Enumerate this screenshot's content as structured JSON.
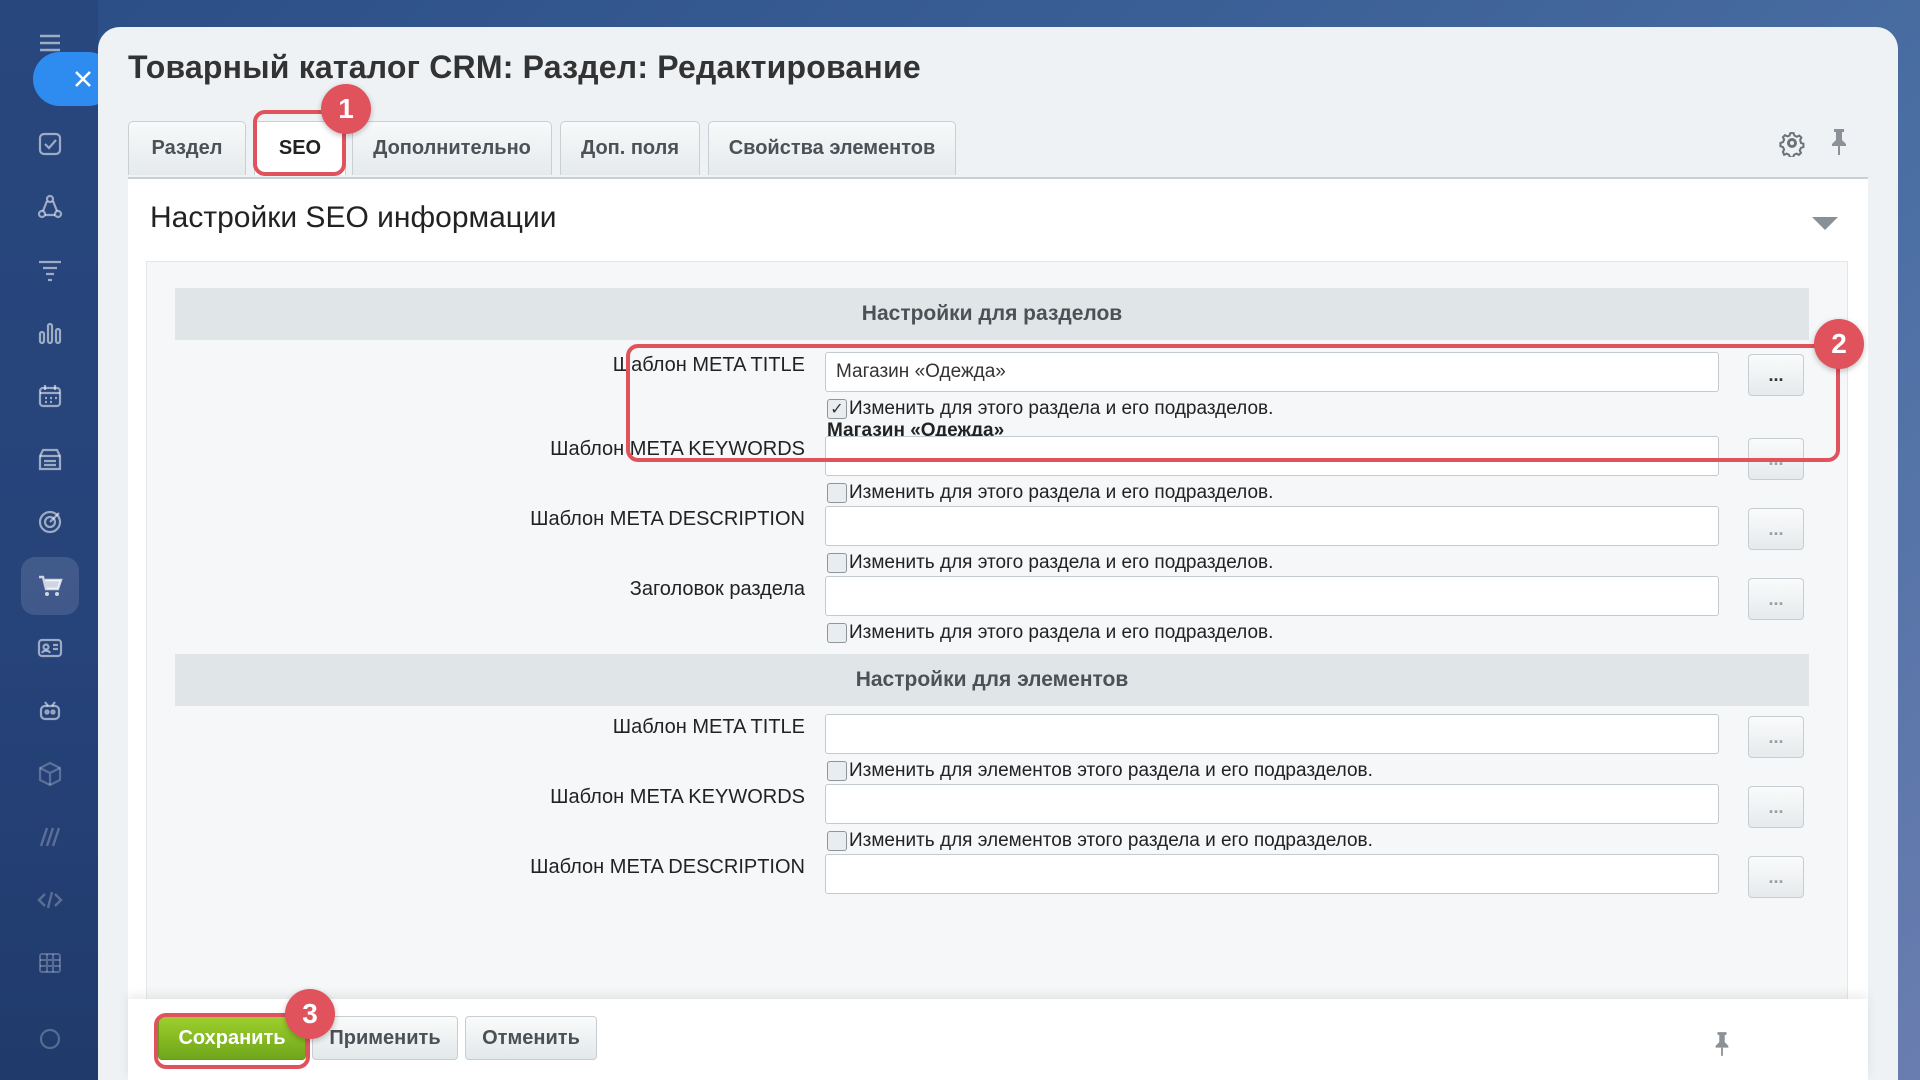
{
  "window": {
    "title": "Товарный каталог CRM: Раздел: Редактирование"
  },
  "tabs": [
    {
      "label": "Раздел"
    },
    {
      "label": "SEO"
    },
    {
      "label": "Дополнительно"
    },
    {
      "label": "Доп. поля"
    },
    {
      "label": "Свойства элементов"
    }
  ],
  "section": {
    "title": "Настройки SEO информации"
  },
  "groups": {
    "sections": {
      "header": "Настройки для разделов",
      "rows": [
        {
          "label": "Шаблон META TITLE",
          "value": "Магазин «Одежда»",
          "checkbox": "Изменить для этого раздела и его подразделов.",
          "checked": true,
          "preview": "Магазин «Одежда»",
          "button": "..."
        },
        {
          "label": "Шаблон META KEYWORDS",
          "value": "",
          "checkbox": "Изменить для этого раздела и его подразделов.",
          "checked": false,
          "button": "..."
        },
        {
          "label": "Шаблон META DESCRIPTION",
          "value": "",
          "checkbox": "Изменить для этого раздела и его подразделов.",
          "checked": false,
          "button": "..."
        },
        {
          "label": "Заголовок раздела",
          "value": "",
          "checkbox": "Изменить для этого раздела и его подразделов.",
          "checked": false,
          "button": "..."
        }
      ]
    },
    "elements": {
      "header": "Настройки для элементов",
      "rows": [
        {
          "label": "Шаблон META TITLE",
          "value": "",
          "checkbox": "Изменить для элементов этого раздела и его подразделов.",
          "checked": false,
          "button": "..."
        },
        {
          "label": "Шаблон META KEYWORDS",
          "value": "",
          "checkbox": "Изменить для элементов этого раздела и его подразделов.",
          "checked": false,
          "button": "..."
        },
        {
          "label": "Шаблон META DESCRIPTION",
          "value": "",
          "button": "..."
        }
      ]
    }
  },
  "footer": {
    "save_label": "Сохранить",
    "apply_label": "Применить",
    "cancel_label": "Отменить"
  },
  "annotations": [
    {
      "number": "1"
    },
    {
      "number": "2"
    },
    {
      "number": "3"
    }
  ],
  "colors": {
    "accent": "#e0525c",
    "save_button": "#7cb81f",
    "close_button": "#2e8cf0"
  }
}
